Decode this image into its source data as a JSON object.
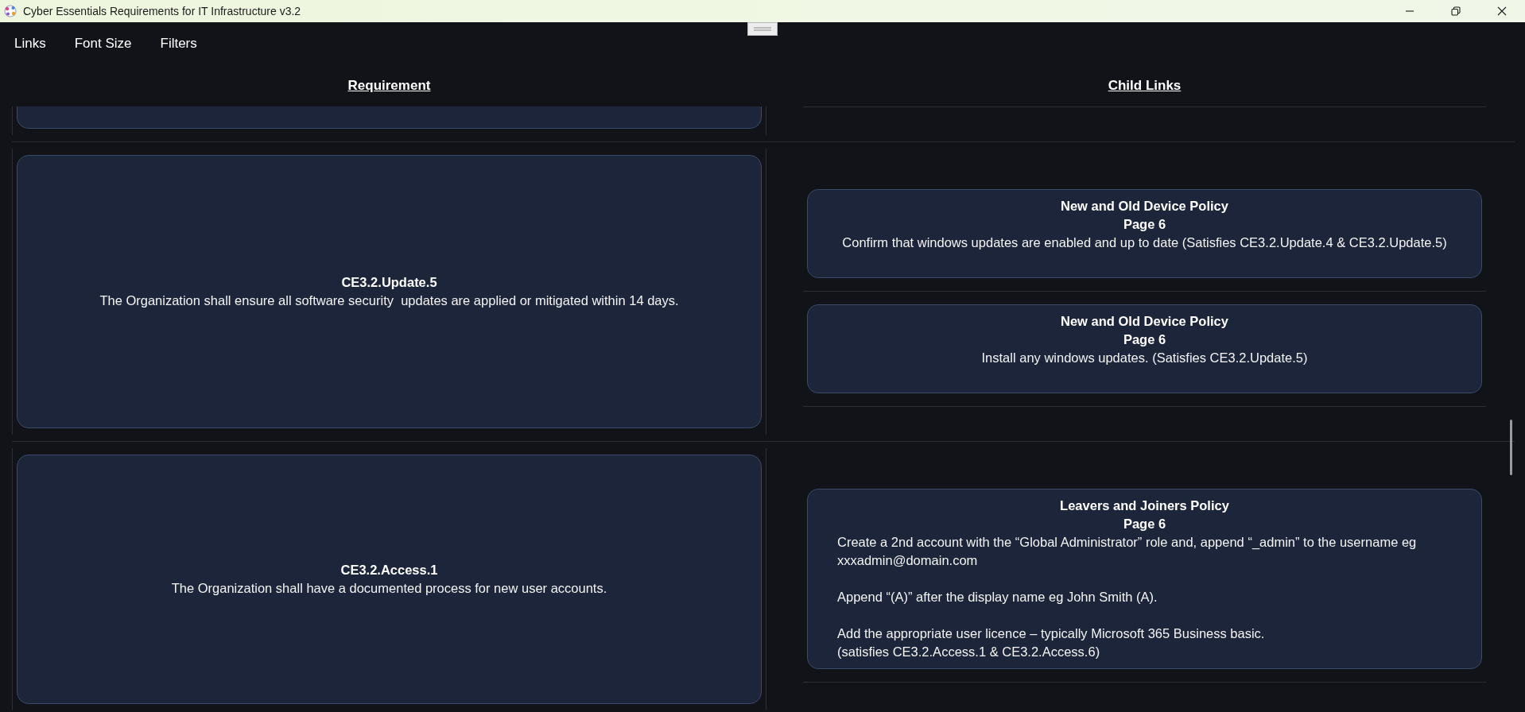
{
  "window": {
    "title": "Cyber Essentials Requirements for IT Infrastructure v3.2"
  },
  "menu": [
    {
      "label": "Links"
    },
    {
      "label": "Font Size"
    },
    {
      "label": "Filters"
    }
  ],
  "table": {
    "columns": [
      "Requirement",
      "Child Links"
    ],
    "rows": [
      {
        "kind": "clipped"
      },
      {
        "kind": "full",
        "requirement": {
          "id": "CE3.2.Update.5",
          "text": "The Organization shall ensure all software security  updates are applied or mitigated within 14 days."
        },
        "child_links": [
          {
            "kind": "summary",
            "title": "New and Old Device Policy",
            "page": "Page 6",
            "detail": "Confirm that windows updates are enabled and up to date (Satisfies CE3.2.Update.4 & CE3.2.Update.5)"
          },
          {
            "kind": "summary",
            "title": "New and Old Device Policy",
            "page": "Page 6",
            "detail": "Install any windows updates. (Satisfies CE3.2.Update.5)"
          }
        ]
      },
      {
        "kind": "full",
        "requirement": {
          "id": "CE3.2.Access.1",
          "text": "The Organization shall have a documented process for new user accounts."
        },
        "child_links": [
          {
            "kind": "steps",
            "title": "Leavers and Joiners Policy",
            "page": "Page 6",
            "paragraphs": [
              [
                "Create a 2nd account with the “Global Administrator” role and, append “_admin” to the username eg xxxadmin@domain.com"
              ],
              [
                "Append “(A)” after the display name eg John Smith (A)."
              ],
              [
                "Add the appropriate user licence – typically Microsoft 365 Business basic.",
                "(satisfies CE3.2.Access.1 & CE3.2.Access.6)"
              ]
            ]
          }
        ]
      }
    ]
  }
}
